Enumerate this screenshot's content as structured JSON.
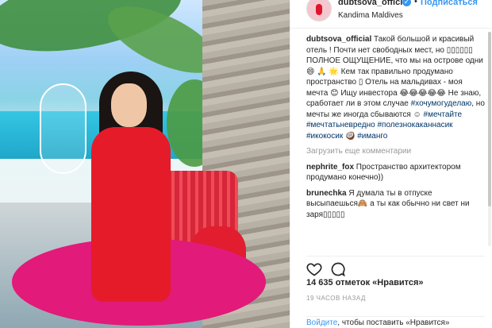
{
  "header": {
    "username": "dubtsova_official",
    "verified_mark": "✓",
    "separator": "•",
    "follow_label": "Подписаться",
    "location": "Kandima Maldives"
  },
  "caption": {
    "username": "dubtsova_official",
    "text": "Такой большой и красивый отель ! Почти нет свободных мест, но ▯▯▯▯▯▯ ПОЛНОЕ ОЩУЩЕНИЕ, что мы на острове одни 😄 🙏 🌟 Кем так правильно продумано пространство ▯ Отель на мальдивах - моя мечта 😊 Ищу инвестора 😂😂😂😂😂 Не знаю, сработает ли в этом случае ",
    "hashtag_1": "#хочумогуделаю",
    "text_2": ", но мечты же иногда сбываются ☺",
    "hashtag_2": "#мечтайте",
    "hashtag_3": "#мечтатьневредно",
    "hashtag_4": "#полезнокаканнасик",
    "hashtag_5": "#икокосик",
    "hashtag_6": "#иманго",
    "after_icokosik": "🥥"
  },
  "load_more": "Загрузить еще комментарии",
  "comments": [
    {
      "username": "nephrite_fox",
      "text": "Пространство архитектором продумано конечно))"
    },
    {
      "username": "brunechka",
      "text": "Я думала ты в отпуске высыпаешься🙈 а ты как обычно ни свет ни заря▯▯▯▯▯"
    }
  ],
  "likes": "14 635 отметок «Нравится»",
  "time": "19 ЧАСОВ НАЗАД",
  "login": {
    "link": "Войдите",
    "text": ", чтобы поставить «Нравится»"
  },
  "colors": {
    "link": "#3897f0",
    "hashtag": "#003569",
    "dress": "#e51b2a",
    "seat": "#e21a79"
  }
}
